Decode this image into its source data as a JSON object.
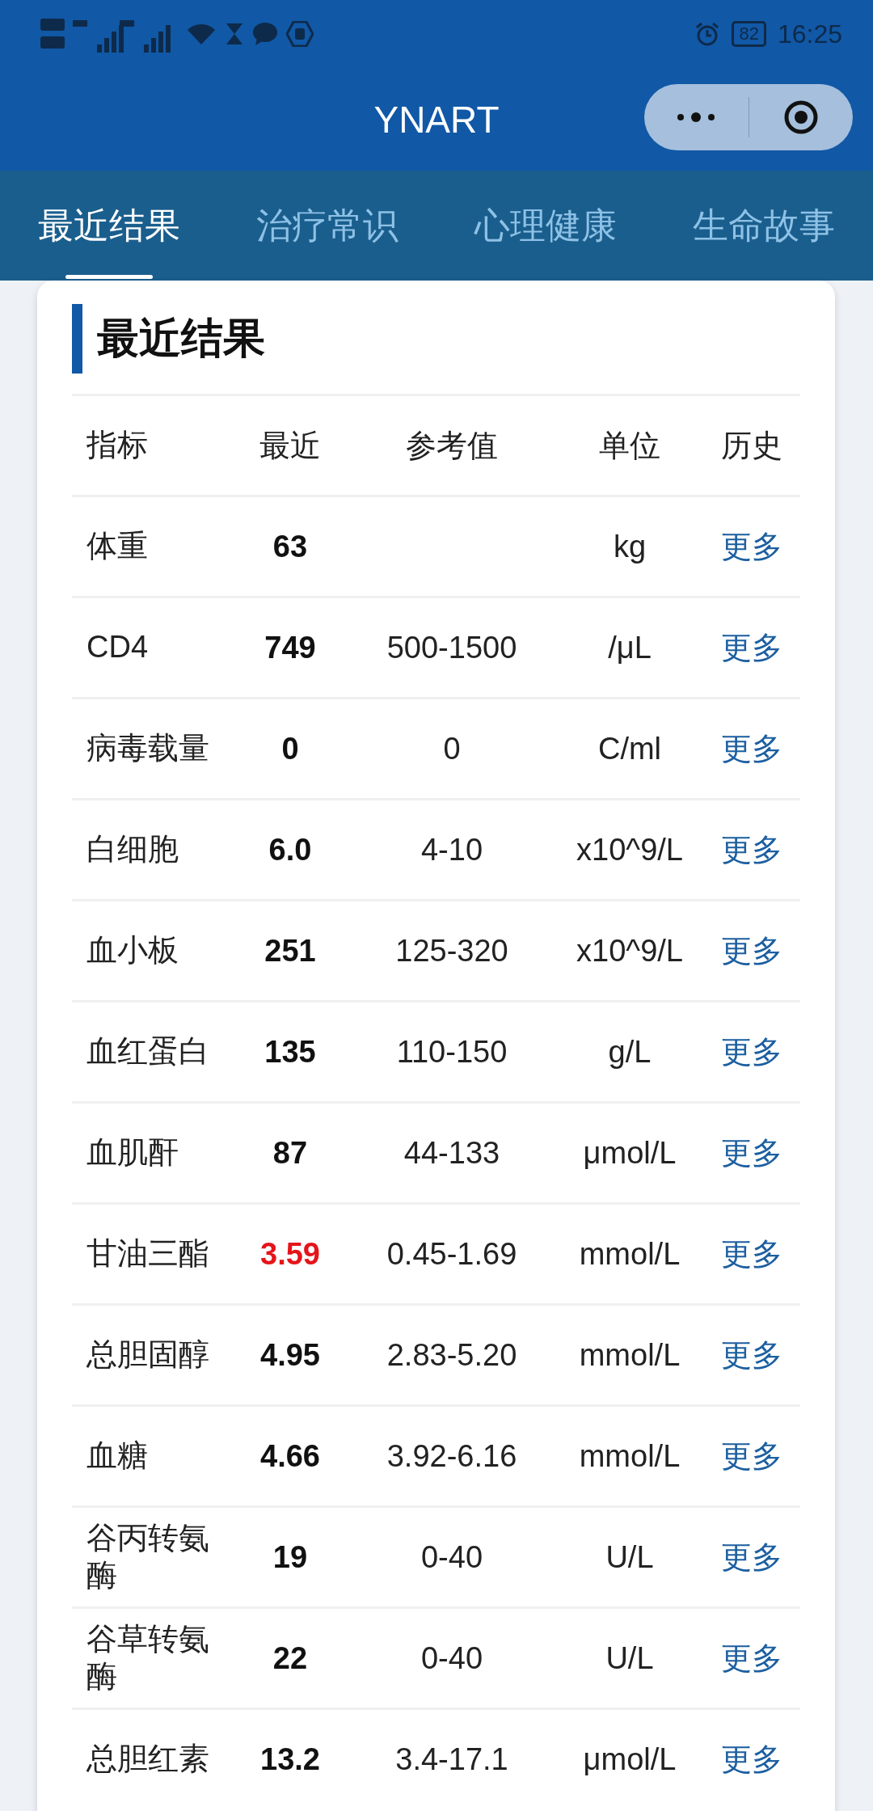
{
  "status_bar": {
    "battery": "82",
    "time": "16:25"
  },
  "header": {
    "title": "YNART"
  },
  "tabs": [
    {
      "label": "最近结果",
      "selected": true
    },
    {
      "label": "治疗常识",
      "selected": false
    },
    {
      "label": "心理健康",
      "selected": false
    },
    {
      "label": "生命故事",
      "selected": false
    }
  ],
  "card": {
    "title": "最近结果",
    "columns": [
      "指标",
      "最近",
      "参考值",
      "单位",
      "历史"
    ],
    "rows": [
      {
        "name": "体重",
        "latest": "63",
        "reference": "",
        "unit": "kg",
        "history": "更多",
        "abnormal": false
      },
      {
        "name": "CD4",
        "latest": "749",
        "reference": "500-1500",
        "unit": "/μL",
        "history": "更多",
        "abnormal": false
      },
      {
        "name": "病毒载量",
        "latest": "0",
        "reference": "0",
        "unit": "C/ml",
        "history": "更多",
        "abnormal": false
      },
      {
        "name": "白细胞",
        "latest": "6.0",
        "reference": "4-10",
        "unit": "x10^9/L",
        "history": "更多",
        "abnormal": false
      },
      {
        "name": "血小板",
        "latest": "251",
        "reference": "125-320",
        "unit": "x10^9/L",
        "history": "更多",
        "abnormal": false
      },
      {
        "name": "血红蛋白",
        "latest": "135",
        "reference": "110-150",
        "unit": "g/L",
        "history": "更多",
        "abnormal": false
      },
      {
        "name": "血肌酐",
        "latest": "87",
        "reference": "44-133",
        "unit": "μmol/L",
        "history": "更多",
        "abnormal": false
      },
      {
        "name": "甘油三酯",
        "latest": "3.59",
        "reference": "0.45-1.69",
        "unit": "mmol/L",
        "history": "更多",
        "abnormal": true
      },
      {
        "name": "总胆固醇",
        "latest": "4.95",
        "reference": "2.83-5.20",
        "unit": "mmol/L",
        "history": "更多",
        "abnormal": false
      },
      {
        "name": "血糖",
        "latest": "4.66",
        "reference": "3.92-6.16",
        "unit": "mmol/L",
        "history": "更多",
        "abnormal": false
      },
      {
        "name": "谷丙转氨酶",
        "latest": "19",
        "reference": "0-40",
        "unit": "U/L",
        "history": "更多",
        "abnormal": false
      },
      {
        "name": "谷草转氨酶",
        "latest": "22",
        "reference": "0-40",
        "unit": "U/L",
        "history": "更多",
        "abnormal": false
      },
      {
        "name": "总胆红素",
        "latest": "13.2",
        "reference": "3.4-17.1",
        "unit": "μmol/L",
        "history": "更多",
        "abnormal": false
      }
    ]
  }
}
